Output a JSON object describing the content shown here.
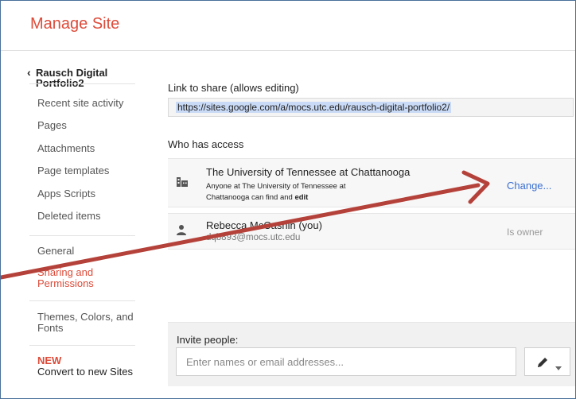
{
  "header": {
    "title": "Manage Site"
  },
  "sidebar": {
    "back_label": "Rausch Digital Portfolio2",
    "items": [
      {
        "label": "Recent site activity"
      },
      {
        "label": "Pages"
      },
      {
        "label": "Attachments"
      },
      {
        "label": "Page templates"
      },
      {
        "label": "Apps Scripts"
      },
      {
        "label": "Deleted items"
      },
      {
        "label": "General"
      },
      {
        "label": "Sharing and Permissions"
      },
      {
        "label": "Themes, Colors, and Fonts"
      }
    ],
    "new_badge": "NEW",
    "new_item": "Convert to new Sites"
  },
  "sharing": {
    "link_label": "Link to share (allows editing)",
    "link_url": "https://sites.google.com/a/mocs.utc.edu/rausch-digital-portfolio2/",
    "who_label": "Who has access",
    "org": {
      "name": "The University of Tennessee at Chattanooga",
      "desc_prefix": "Anyone at The University of Tennessee at Chattanooga can find and ",
      "desc_bold": "edit",
      "change_label": "Change..."
    },
    "owner": {
      "name": "Rebecca McCashin (you)",
      "email": "dqb893@mocs.utc.edu",
      "role": "Is owner"
    },
    "invite": {
      "label": "Invite people:",
      "placeholder": "Enter names or email addresses..."
    }
  },
  "colors": {
    "accent": "#dd4b39",
    "link": "#3b6fd1",
    "arrow": "#b5423a"
  }
}
